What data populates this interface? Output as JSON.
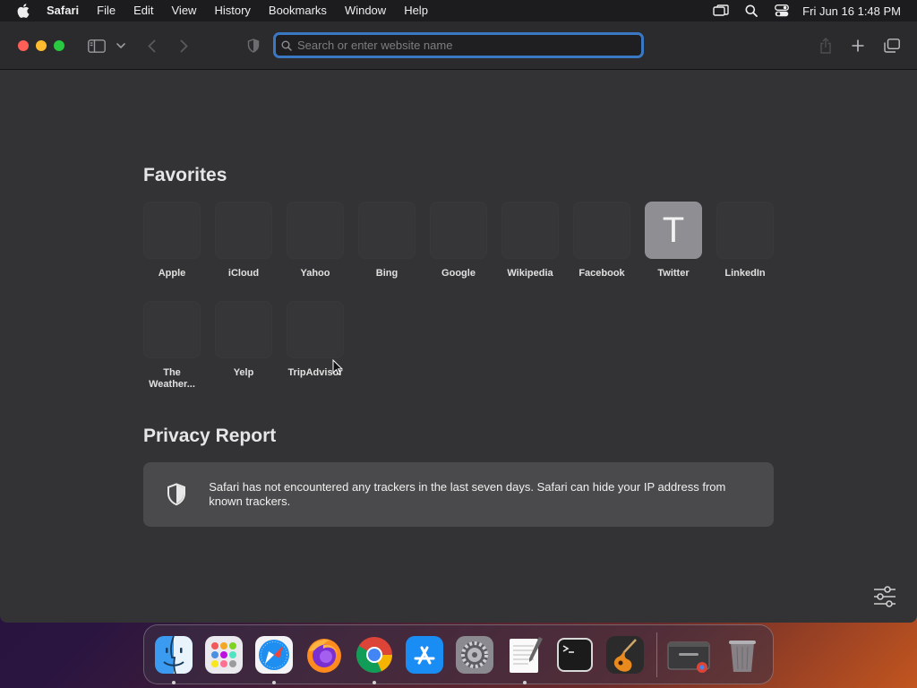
{
  "menubar": {
    "app_name": "Safari",
    "items": [
      "File",
      "Edit",
      "View",
      "History",
      "Bookmarks",
      "Window",
      "Help"
    ],
    "clock": "Fri Jun 16  1:48 PM"
  },
  "toolbar": {
    "address_placeholder": "Search or enter website name"
  },
  "favorites": {
    "title": "Favorites",
    "items": [
      {
        "label": "Apple"
      },
      {
        "label": "iCloud"
      },
      {
        "label": "Yahoo"
      },
      {
        "label": "Bing"
      },
      {
        "label": "Google"
      },
      {
        "label": "Wikipedia"
      },
      {
        "label": "Facebook"
      },
      {
        "label": "Twitter",
        "letter": "T"
      },
      {
        "label": "LinkedIn"
      },
      {
        "label": "The Weather..."
      },
      {
        "label": "Yelp"
      },
      {
        "label": "TripAdvisor"
      }
    ]
  },
  "privacy": {
    "title": "Privacy Report",
    "text": "Safari has not encountered any trackers in the last seven days. Safari can hide your IP address from known trackers."
  },
  "colors": {
    "accent_focus": "#3a78c4",
    "close": "#ff5f57",
    "minimize": "#febc2e",
    "zoom": "#28c840"
  },
  "dock": {
    "apps": [
      "finder-icon",
      "launchpad-icon",
      "safari-icon",
      "firefox-icon",
      "chrome-icon",
      "app-store-icon",
      "system-settings-icon",
      "textedit-icon",
      "terminal-icon",
      "garageband-icon",
      "chrome-window-icon",
      "trash-icon"
    ]
  }
}
